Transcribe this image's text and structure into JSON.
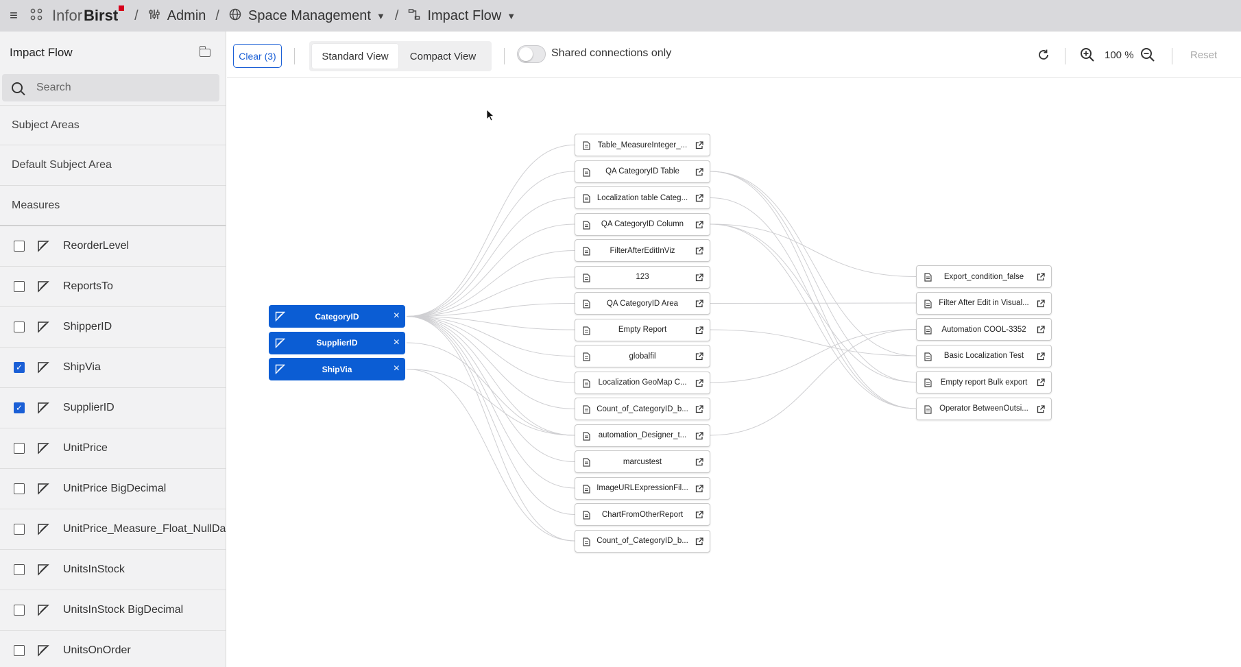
{
  "topbar": {
    "brand_part1": "Infor",
    "brand_part2": "Birst",
    "crumbs": [
      "Admin",
      "Space Management",
      "Impact Flow"
    ]
  },
  "sidebar": {
    "title": "Impact Flow",
    "search_placeholder": "Search",
    "sections": [
      "Subject Areas",
      "Default Subject Area",
      "Measures"
    ],
    "items": [
      {
        "label": "ReorderLevel",
        "checked": false
      },
      {
        "label": "ReportsTo",
        "checked": false
      },
      {
        "label": "ShipperID",
        "checked": false
      },
      {
        "label": "ShipVia",
        "checked": true
      },
      {
        "label": "SupplierID",
        "checked": true
      },
      {
        "label": "UnitPrice",
        "checked": false
      },
      {
        "label": "UnitPrice BigDecimal",
        "checked": false
      },
      {
        "label": "UnitPrice_Measure_Float_NullData",
        "checked": false
      },
      {
        "label": "UnitsInStock",
        "checked": false
      },
      {
        "label": "UnitsInStock BigDecimal",
        "checked": false
      },
      {
        "label": "UnitsOnOrder",
        "checked": false
      }
    ]
  },
  "toolbar": {
    "clear_label": "Clear (3)",
    "standard_view": "Standard View",
    "compact_view": "Compact View",
    "shared_toggle_label": "Shared connections only",
    "shared_toggle_on": false,
    "zoom": "100 %",
    "reset_label": "Reset"
  },
  "graph": {
    "sources": [
      "CategoryID",
      "SupplierID",
      "ShipVia"
    ],
    "middle": [
      "Table_MeasureInteger_...",
      "QA CategoryID Table",
      "Localization table Categ...",
      "QA CategoryID Column",
      "FilterAfterEditInViz",
      "123",
      "QA CategoryID Area",
      "Empty Report",
      "globalfil",
      "Localization GeoMap C...",
      "Count_of_CategoryID_b...",
      "automation_Designer_t...",
      "marcustest",
      "ImageURLExpressionFil...",
      "ChartFromOtherReport",
      "Count_of_CategoryID_b..."
    ],
    "right": [
      "Export_condition_false",
      "Filter After Edit in Visual...",
      "Automation COOL-3352",
      "Basic Localization Test",
      "Empty report Bulk export",
      "Operator BetweenOutsi..."
    ],
    "links_left": [
      [
        0,
        0
      ],
      [
        0,
        1
      ],
      [
        0,
        2
      ],
      [
        0,
        3
      ],
      [
        0,
        4
      ],
      [
        0,
        5
      ],
      [
        0,
        6
      ],
      [
        0,
        7
      ],
      [
        0,
        8
      ],
      [
        0,
        9
      ],
      [
        0,
        10
      ],
      [
        0,
        11
      ],
      [
        0,
        12
      ],
      [
        0,
        13
      ],
      [
        0,
        14
      ],
      [
        0,
        15
      ],
      [
        1,
        11
      ],
      [
        2,
        11
      ],
      [
        2,
        15
      ]
    ],
    "links_right": [
      [
        1,
        3
      ],
      [
        1,
        5
      ],
      [
        3,
        0
      ],
      [
        3,
        4
      ],
      [
        6,
        1
      ],
      [
        7,
        3
      ],
      [
        9,
        2
      ],
      [
        2,
        5
      ],
      [
        11,
        2
      ],
      [
        3,
        5
      ],
      [
        1,
        4
      ]
    ]
  }
}
